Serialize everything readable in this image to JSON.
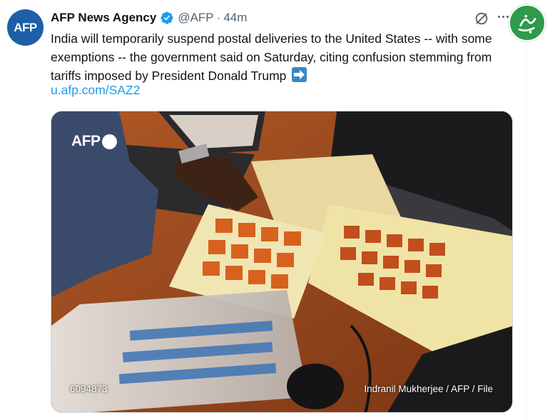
{
  "account": {
    "avatar_text": "AFP",
    "name": "AFP News Agency",
    "handle": "@AFP",
    "separator": "·",
    "time": "44m",
    "verified": true
  },
  "tweet": {
    "text": "India will temporarily suspend postal deliveries to the United States -- with some exemptions -- the government said on Saturday, citing confusion stemming from tariffs imposed by President Donald Trump",
    "emoji": "right-arrow-emoji",
    "link": "u.afp.com/SAZ2"
  },
  "media": {
    "logo_text": "AFP",
    "photo_id": "6094873",
    "credit": "Indranil Mukherjee / AFP / File"
  },
  "icons": {
    "verified": "verified-badge-icon",
    "grok": "grok-icon",
    "more": "more-options-icon",
    "watermark": "channel-watermark-icon"
  },
  "colors": {
    "link": "#1d9bf0",
    "verified": "#1d9bf0",
    "avatar_bg": "#1d5fa8",
    "watermark_bg": "#2e9a4a",
    "muted_text": "#536471"
  }
}
